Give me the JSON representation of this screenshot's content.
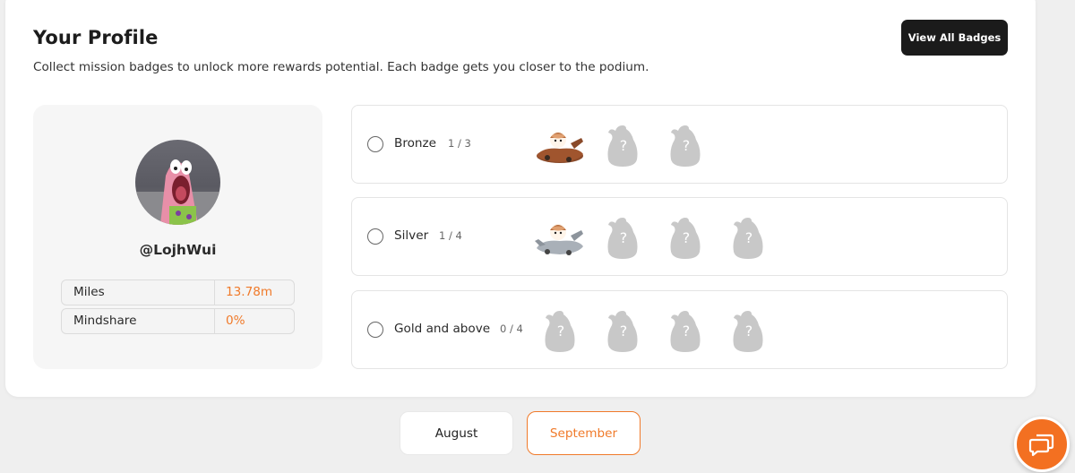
{
  "profile": {
    "title": "Your Profile",
    "subtitle": "Collect mission badges to unlock more rewards potential. Each badge gets you closer to the podium.",
    "view_all_label": "View All Badges",
    "username": "@LojhWui",
    "stats": [
      {
        "label": "Miles",
        "value": "13.78m"
      },
      {
        "label": "Mindshare",
        "value": "0%"
      }
    ]
  },
  "tiers": [
    {
      "name": "Bronze",
      "count": "1 / 3",
      "earned": 1,
      "total": 3,
      "badge_icon": "bronze-plane-badge-icon"
    },
    {
      "name": "Silver",
      "count": "1 / 4",
      "earned": 1,
      "total": 4,
      "badge_icon": "silver-plane-badge-icon"
    },
    {
      "name": "Gold and above",
      "count": "0 / 4",
      "earned": 0,
      "total": 4,
      "badge_icon": "locked-badge-icon"
    }
  ],
  "months": {
    "august": "August",
    "september": "September",
    "selected": "September"
  },
  "colors": {
    "accent": "#f07a2a",
    "button_dark": "#1b1b1b",
    "chat_button": "#f37021",
    "locked_badge": "#c8c8c8"
  },
  "icons": {
    "chat": "chat-bubble-icon",
    "locked": "question-mark-silhouette-icon"
  }
}
